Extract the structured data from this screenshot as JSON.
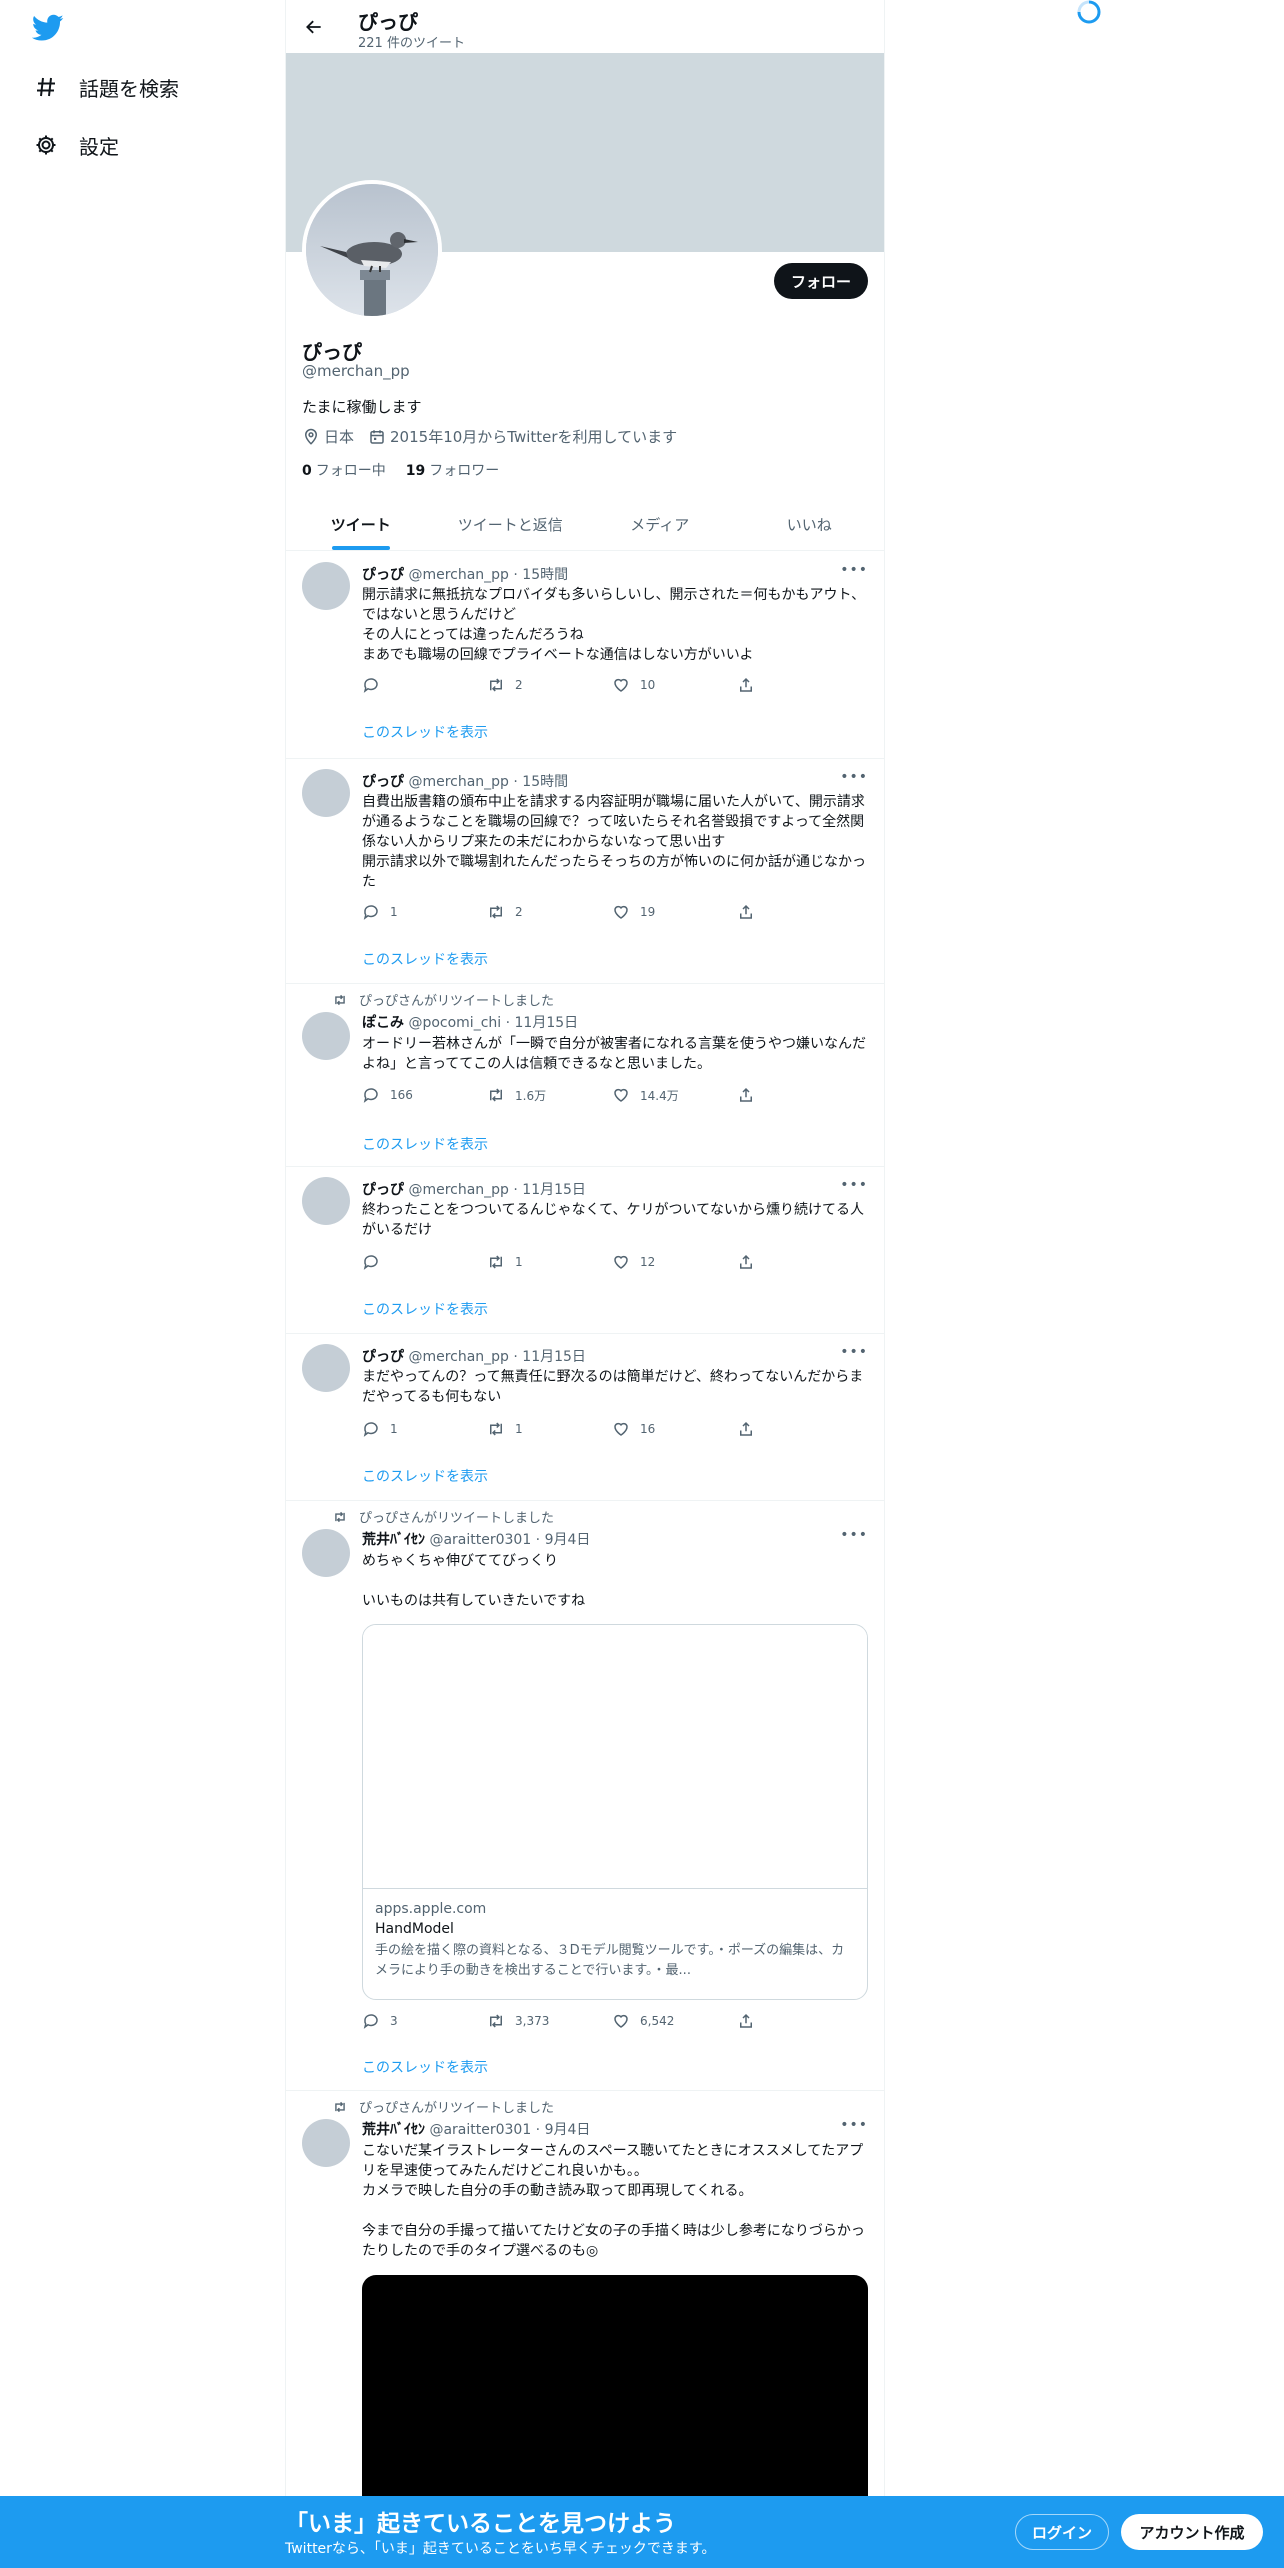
{
  "nav": {
    "items": [
      {
        "label": "話題を検索",
        "icon": "hashtag-icon"
      },
      {
        "label": "設定",
        "icon": "gear-icon"
      }
    ]
  },
  "header": {
    "name": "ぴっぴ",
    "tweet_count": "221 件のツイート"
  },
  "profile": {
    "name": "ぴっぴ",
    "handle": "@merchan_pp",
    "bio": "たまに稼働します",
    "location": "日本",
    "joined": "2015年10月からTwitterを利用しています",
    "following_count": "0",
    "following_label": "フォロー中",
    "followers_count": "19",
    "followers_label": "フォロワー",
    "follow_button": "フォロー"
  },
  "tabs": [
    "ツイート",
    "ツイートと返信",
    "メディア",
    "いいね"
  ],
  "tweets": [
    {
      "name": "ぴっぴ",
      "meta": "@merchan_pp · 15時間",
      "text": "開示請求に無抵抗なプロバイダも多いらしいし、開示された＝何もかもアウト、ではないと思うんだけど\nその人にとっては違ったんだろうね\nまあでも職場の回線でプライベートな通信はしない方がいいよ",
      "reply": "",
      "retweet": "2",
      "like": "10",
      "thread": "このスレッドを表示"
    },
    {
      "name": "ぴっぴ",
      "meta": "@merchan_pp · 15時間",
      "text": "自費出版書籍の頒布中止を請求する内容証明が職場に届いた人がいて、開示請求が通るようなことを職場の回線で？って呟いたらそれ名誉毀損ですよって全然関係ない人からリプ来たの未だにわからないなって思い出す\n開示請求以外で職場割れたんだったらそっちの方が怖いのに何か話が通じなかった",
      "reply": "1",
      "retweet": "2",
      "like": "19",
      "thread": "このスレッドを表示"
    },
    {
      "rt_label": "ぴっぴさんがリツイートしました",
      "name": "ぽこみ",
      "meta": "@pocomi_chi · 11月15日",
      "text": "オードリー若林さんが「一瞬で自分が被害者になれる言葉を使うやつ嫌いなんだよね」と言っててこの人は信頼できるなと思いました。",
      "reply": "166",
      "retweet": "1.6万",
      "like": "14.4万",
      "thread": "このスレッドを表示"
    },
    {
      "name": "ぴっぴ",
      "meta": "@merchan_pp · 11月15日",
      "text": "終わったことをつついてるんじゃなくて、ケリがついてないから燻り続けてる人がいるだけ",
      "reply": "",
      "retweet": "1",
      "like": "12",
      "thread": "このスレッドを表示"
    },
    {
      "name": "ぴっぴ",
      "meta": "@merchan_pp · 11月15日",
      "text": "まだやってんの？って無責任に野次るのは簡単だけど、終わってないんだからまだやってるも何もない",
      "reply": "1",
      "retweet": "1",
      "like": "16",
      "thread": "このスレッドを表示"
    },
    {
      "rt_label": "ぴっぴさんがリツイートしました",
      "name": "荒井ﾊﾞｲｾﾝ",
      "meta": "@araitter0301 · 9月4日",
      "text": "めちゃくちゃ伸びててびっくり\n\nいいものは共有していきたいですね",
      "card_domain": "apps.apple.com",
      "card_title": "HandModel",
      "card_desc": "手の絵を描く際の資料となる、３Dモデル閲覧ツールです。・ポーズの編集は、カメラにより手の動きを検出することで行います。・最...",
      "reply": "3",
      "retweet": "3,373",
      "like": "6,542",
      "thread": "このスレッドを表示"
    },
    {
      "rt_label": "ぴっぴさんがリツイートしました",
      "name": "荒井ﾊﾞｲｾﾝ",
      "meta": "@araitter0301 · 9月4日",
      "text": "こないだ某イラストレーターさんのスペース聴いてたときにオススメしてたアプリを早速使ってみたんだけどこれ良いかも。。\nカメラで映した自分の手の動き読み取って即再現してくれる。\n\n今まで自分の手撮って描いてたけど女の子の手描く時は少し参考になりづらかったりしたので手のタイプ選べるのも◎"
    }
  ],
  "bottom_banner": {
    "title": "「いま」起きていることを見つけよう",
    "subtitle": "Twitterなら、「いま」起きていることをいち早くチェックできます。",
    "login": "ログイン",
    "signup": "アカウント作成"
  },
  "colors": {
    "accent": "#1d9bf0",
    "banner": "#cfd9de",
    "text": "#0f1419",
    "secondary": "#536471"
  }
}
